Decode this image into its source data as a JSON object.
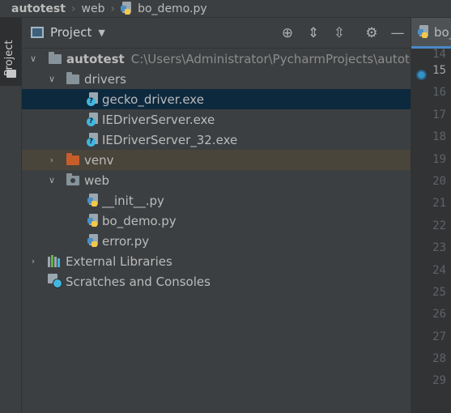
{
  "breadcrumb": {
    "items": [
      "autotest",
      "web",
      "bo_demo.py"
    ]
  },
  "toolstrip": {
    "tab_label": "Project"
  },
  "project_panel": {
    "title": "Project",
    "tree": {
      "root": {
        "label": "autotest",
        "path": "C:\\Users\\Administrator\\PycharmProjects\\autotest"
      },
      "drivers": {
        "label": "drivers"
      },
      "driver_files": [
        "gecko_driver.exe",
        "IEDriverServer.exe",
        "IEDriverServer_32.exe"
      ],
      "venv": {
        "label": "venv"
      },
      "web": {
        "label": "web"
      },
      "web_files": [
        "__init__.py",
        "bo_demo.py",
        "error.py"
      ],
      "external_libraries": "External Libraries",
      "scratches": "Scratches and Consoles"
    }
  },
  "editor": {
    "tab_label": "bo_demo.py",
    "line_numbers": [
      "14",
      "15",
      "16",
      "17",
      "18",
      "19",
      "20",
      "21",
      "22",
      "23",
      "24",
      "25",
      "26",
      "27",
      "28",
      "29"
    ],
    "current_line": "15"
  },
  "colors": {
    "selection": "#0d293e",
    "excluded_folder": "#c75e2a",
    "accent": "#4a88c7"
  }
}
